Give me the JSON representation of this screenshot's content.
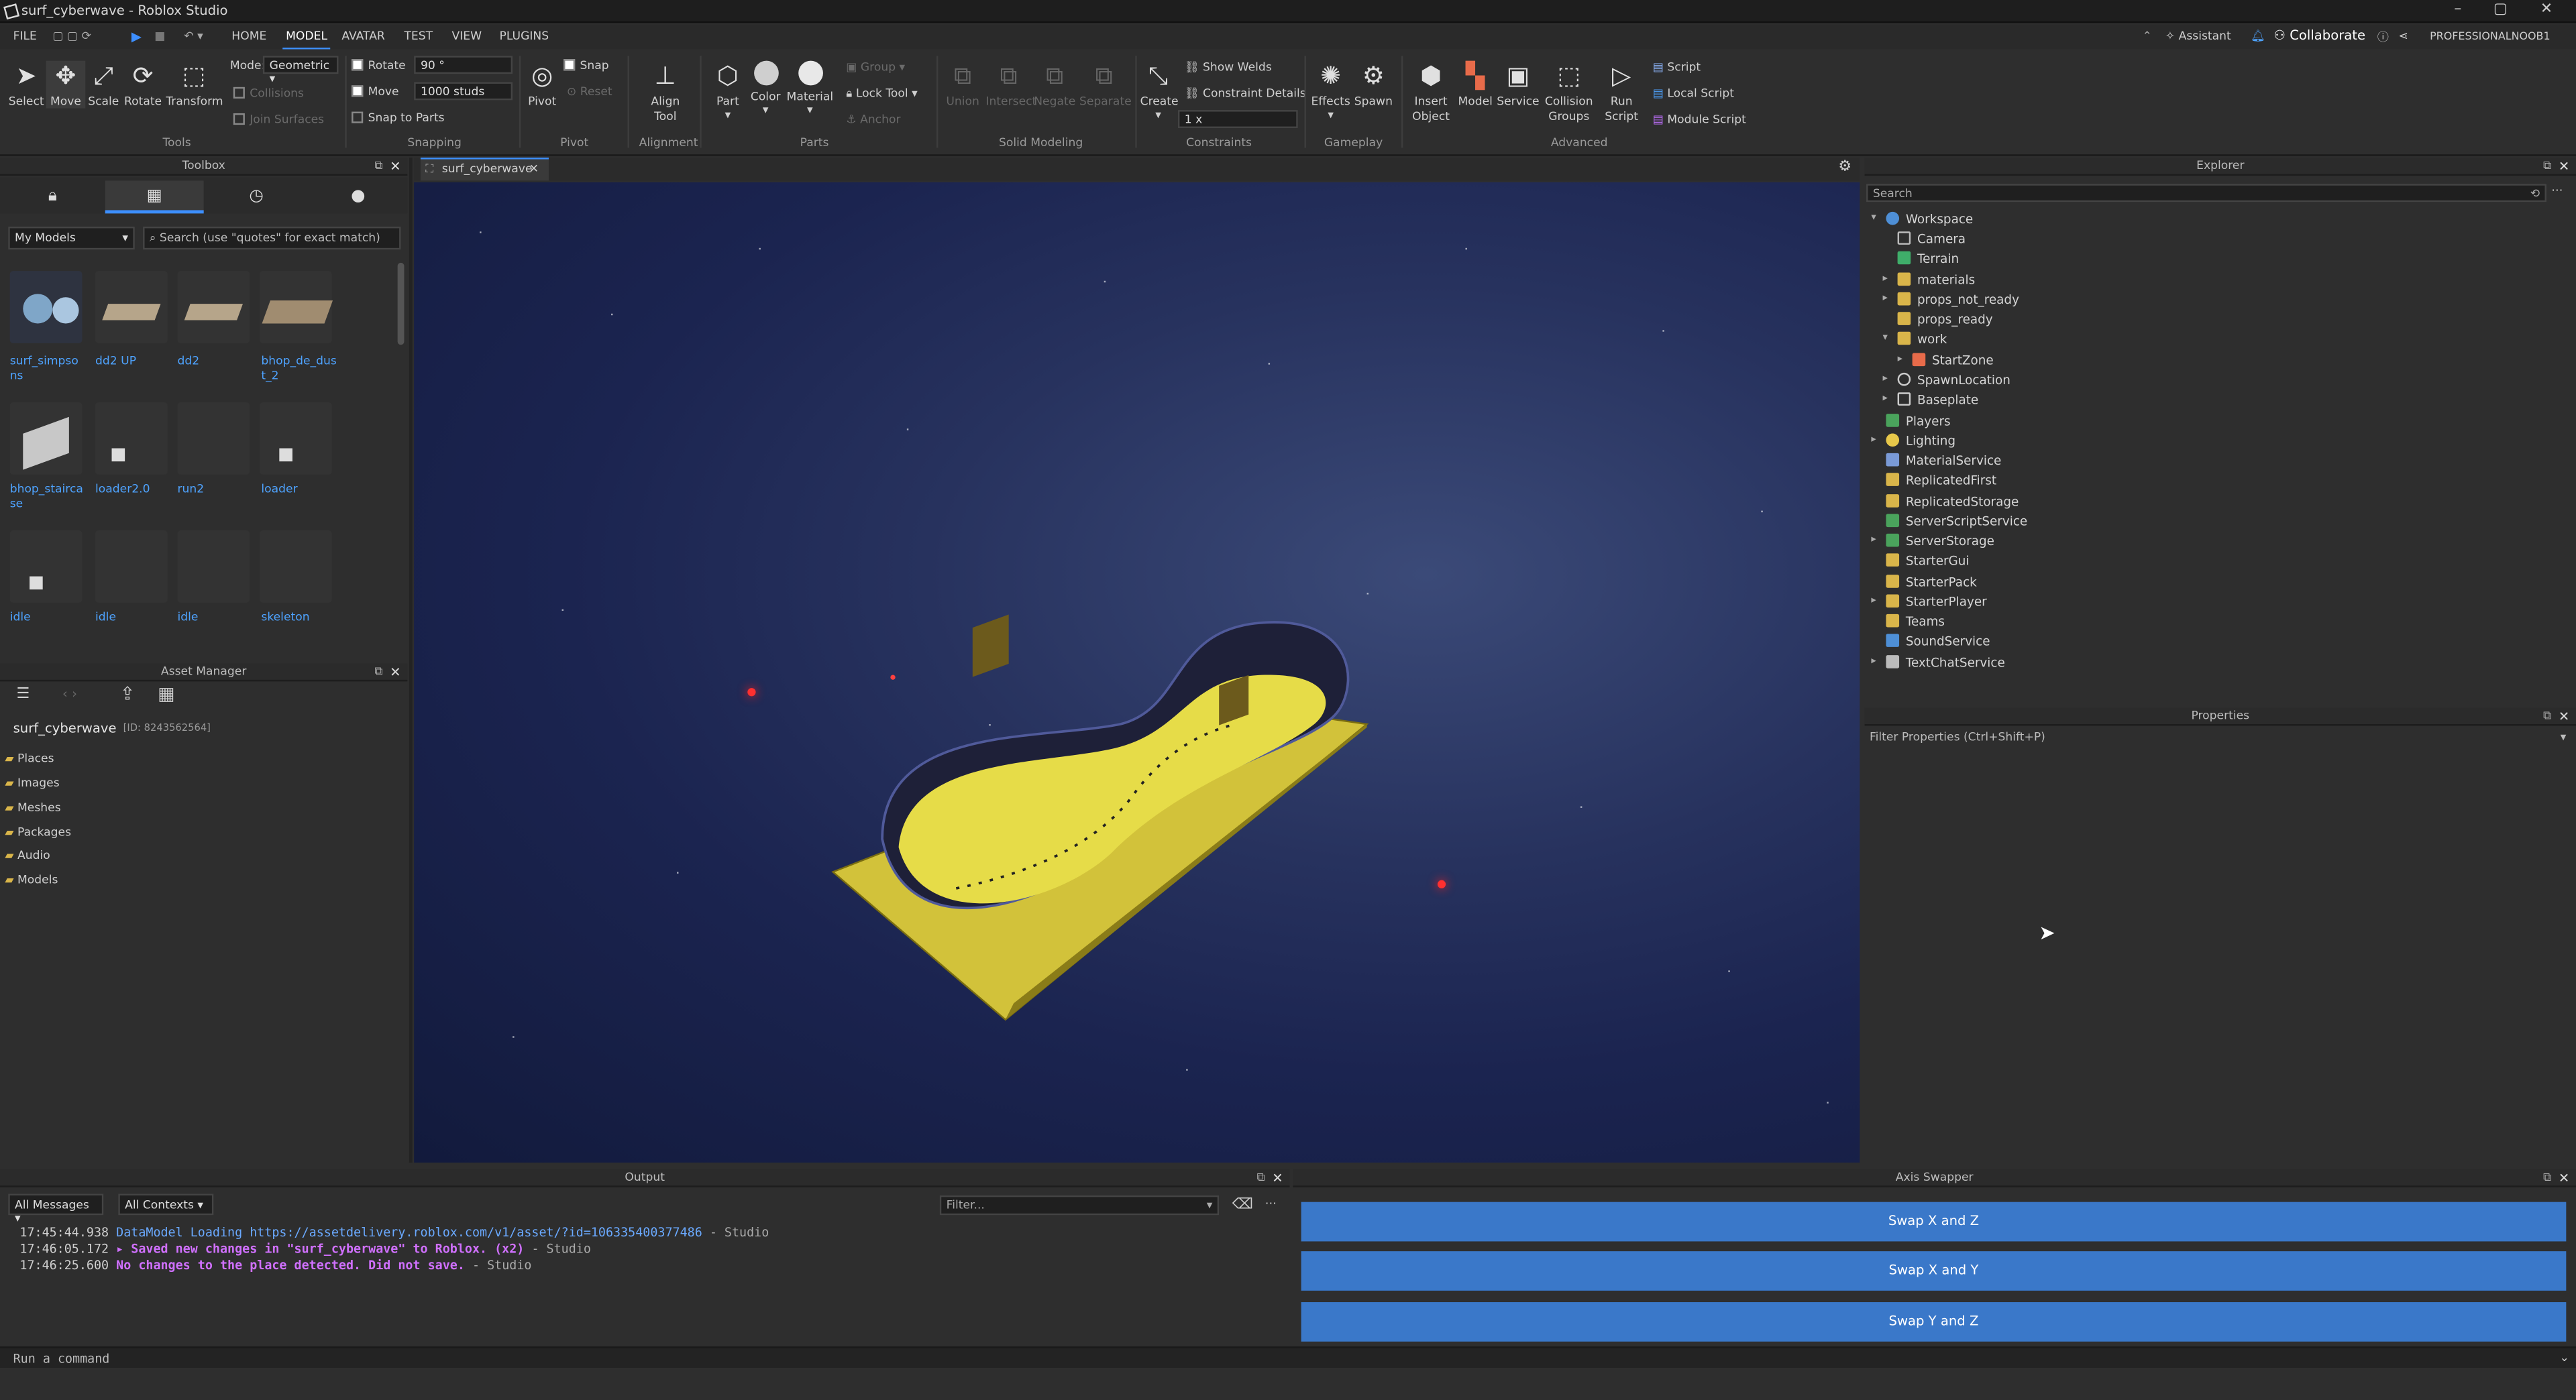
{
  "window": {
    "title": "surf_cyberwave - Roblox Studio",
    "minimize": "–",
    "maximize": "▢",
    "close": "✕"
  },
  "menu": {
    "file": "FILE",
    "home": "HOME",
    "model": "MODEL",
    "avatar": "AVATAR",
    "test": "TEST",
    "view": "VIEW",
    "plugins": "PLUGINS",
    "assistant": "Assistant",
    "collaborate": "Collaborate",
    "user": "PROFESSIONALNOOB1"
  },
  "ribbon": {
    "tools": {
      "select": "Select",
      "move": "Move",
      "scale": "Scale",
      "rotate": "Rotate",
      "transform": "Transform",
      "group": "Tools"
    },
    "mode_label": "Mode:",
    "mode_value": "Geometric",
    "collisions": "Collisions",
    "join_surfaces": "Join Surfaces",
    "snapping": {
      "rotate": "Rotate",
      "rotate_value": "90 °",
      "move": "Move",
      "move_value": "1000 studs",
      "snap_to_parts": "Snap to Parts",
      "group": "Snapping"
    },
    "pivot": {
      "pivot": "Pivot",
      "snap": "Snap",
      "reset": "Reset",
      "group": "Pivot"
    },
    "alignment": {
      "align_tool": "Align Tool",
      "group": "Alignment"
    },
    "parts": {
      "part": "Part",
      "color": "Color",
      "material": "Material",
      "group_btn": "Group",
      "lock_tool": "Lock Tool",
      "anchor": "Anchor",
      "group": "Parts"
    },
    "solid": {
      "union": "Union",
      "intersect": "Intersect",
      "negate": "Negate",
      "separate": "Separate",
      "group": "Solid Modeling"
    },
    "constraints": {
      "create": "Create",
      "show_welds": "Show Welds",
      "constraint_details": "Constraint Details",
      "scale_value": "1 x",
      "group": "Constraints"
    },
    "gameplay": {
      "effects": "Effects",
      "spawn": "Spawn",
      "group": "Gameplay"
    },
    "advanced": {
      "insert_object": "Insert Object",
      "model": "Model",
      "service": "Service",
      "collision_groups": "Collision Groups",
      "run_script": "Run Script",
      "script": "Script",
      "local_script": "Local Script",
      "module_script": "Module Script",
      "group": "Advanced"
    }
  },
  "toolbox": {
    "title": "Toolbox",
    "category": "My Models",
    "search_placeholder": "Search (use \"quotes\" for exact match)",
    "items": [
      "surf_simpsons",
      "dd2 UP",
      "dd2",
      "bhop_de_dust_2",
      "bhop_staircase",
      "loader2.0",
      "run2",
      "loader",
      "idle",
      "idle",
      "idle",
      "skeleton"
    ]
  },
  "asset_manager": {
    "title": "Asset Manager",
    "place": "surf_cyberwave",
    "id": "[ID: 8243562564]",
    "folders": [
      "Places",
      "Images",
      "Meshes",
      "Packages",
      "Audio",
      "Models"
    ]
  },
  "tab": {
    "label": "surf_cyberwave",
    "close": "✕"
  },
  "explorer": {
    "title": "Explorer",
    "search_placeholder": "Search",
    "nodes": [
      "Workspace",
      "Camera",
      "Terrain",
      "materials",
      "props_not_ready",
      "props_ready",
      "work",
      "StartZone",
      "SpawnLocation",
      "Baseplate",
      "Players",
      "Lighting",
      "MaterialService",
      "ReplicatedFirst",
      "ReplicatedStorage",
      "ServerScriptService",
      "ServerStorage",
      "StarterGui",
      "StarterPack",
      "StarterPlayer",
      "Teams",
      "SoundService",
      "TextChatService"
    ]
  },
  "properties": {
    "title": "Properties",
    "filter_placeholder": "Filter Properties (Ctrl+Shift+P)"
  },
  "output": {
    "title": "Output",
    "filter_messages": "All Messages",
    "filter_contexts": "All Contexts",
    "filter_placeholder": "Filter...",
    "lines": [
      {
        "time": "17:45:44.938",
        "msg": "DataModel Loading https://assetdelivery.roblox.com/v1/asset/?id=106335400377486",
        "src": "-  Studio",
        "color": "#6aa9ff"
      },
      {
        "time": "17:46:05.172",
        "msg": "▸ Saved new changes in \"surf_cyberwave\" to Roblox. (x2)",
        "src": "-  Studio",
        "color": "#c070ff"
      },
      {
        "time": "17:46:25.600",
        "msg": "No changes to the place detected. Did not save.",
        "src": "-  Studio",
        "color": "#c070ff"
      }
    ]
  },
  "axis_swapper": {
    "title": "Axis Swapper",
    "buttons": [
      "Swap X and Z",
      "Swap X and Y",
      "Swap Y and Z"
    ]
  },
  "command": {
    "placeholder": "Run a command"
  }
}
